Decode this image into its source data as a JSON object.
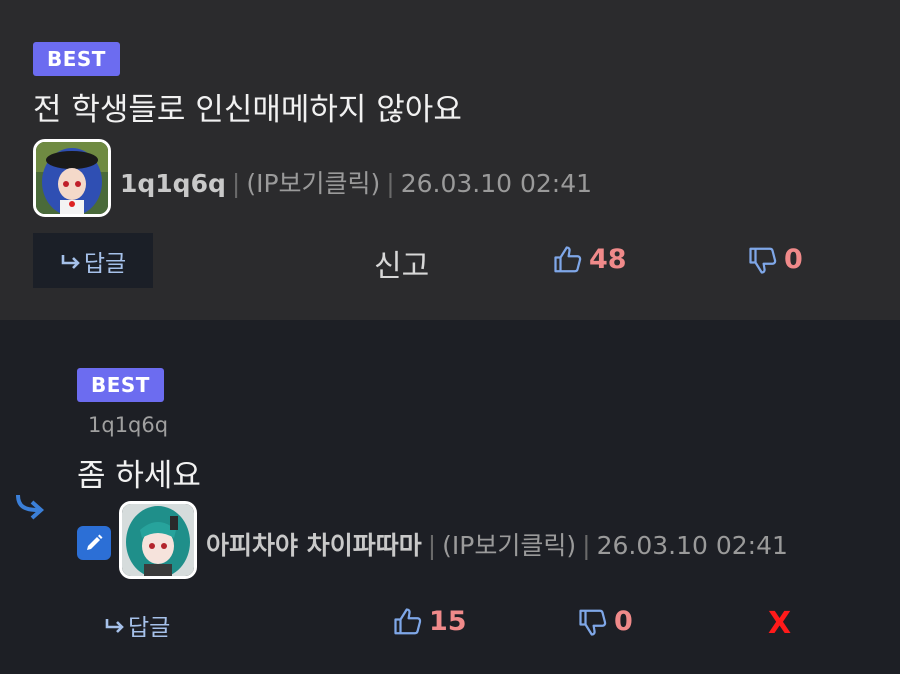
{
  "comment": {
    "badge": "BEST",
    "text": "전 학생들로 인신매메하지 않아요",
    "author": "1q1q6q",
    "ip": "(IP보기클릭)",
    "time": "26.03.10 02:41",
    "reply_label": "답글",
    "report_label": "신고",
    "likes": "48",
    "dislikes": "0"
  },
  "reply": {
    "badge": "BEST",
    "mention": "1q1q6q",
    "text": "좀 하세요",
    "author": "아피차야 차이파따마",
    "ip": "(IP보기클릭)",
    "time": "26.03.10 02:41",
    "reply_label": "답글",
    "likes": "15",
    "dislikes": "0",
    "delete_label": "X"
  },
  "colors": {
    "badge": "#6c6cf0",
    "vote_count": "#f08a8a",
    "reply_link": "#a6c1ea",
    "delete": "#ff1a1a",
    "edit": "#2c6fd6"
  }
}
